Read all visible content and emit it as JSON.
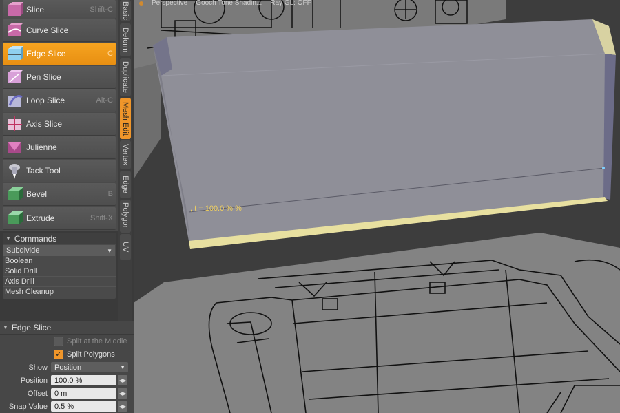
{
  "tools": [
    {
      "label": "Slice",
      "shortcut": "Shift-C",
      "icon": "slice-icon",
      "active": false
    },
    {
      "label": "Curve Slice",
      "shortcut": "",
      "icon": "curve-slice-icon",
      "active": false
    },
    {
      "label": "Edge Slice",
      "shortcut": "C",
      "icon": "edge-slice-icon",
      "active": true
    },
    {
      "label": "Pen Slice",
      "shortcut": "",
      "icon": "pen-slice-icon",
      "active": false
    },
    {
      "label": "Loop Slice",
      "shortcut": "Alt-C",
      "icon": "loop-slice-icon",
      "active": false
    },
    {
      "label": "Axis Slice",
      "shortcut": "",
      "icon": "axis-slice-icon",
      "active": false
    },
    {
      "label": "Julienne",
      "shortcut": "",
      "icon": "julienne-icon",
      "active": false
    },
    {
      "label": "Tack Tool",
      "shortcut": "",
      "icon": "tack-tool-icon",
      "active": false
    },
    {
      "label": "Bevel",
      "shortcut": "B",
      "icon": "bevel-icon",
      "active": false
    },
    {
      "label": "Extrude",
      "shortcut": "Shift-X",
      "icon": "extrude-icon",
      "active": false
    }
  ],
  "tabs": [
    {
      "label": "Basic",
      "active": false
    },
    {
      "label": "Deform",
      "active": false
    },
    {
      "label": "Duplicate",
      "active": false
    },
    {
      "label": "Mesh Edit",
      "active": true
    },
    {
      "label": "Vertex",
      "active": false
    },
    {
      "label": "Edge",
      "active": false
    },
    {
      "label": "Polygon",
      "active": false
    },
    {
      "label": "UV",
      "active": false
    }
  ],
  "commands": {
    "header": "Commands",
    "selected": "Subdivide",
    "items": [
      "Boolean",
      "Solid Drill",
      "Axis Drill",
      "Mesh Cleanup"
    ]
  },
  "properties": {
    "header": "Edge Slice",
    "split_middle_label": "Split at the Middle",
    "split_middle_checked": false,
    "split_polygons_label": "Split Polygons",
    "split_polygons_checked": true,
    "show_label": "Show",
    "show_value": "Position",
    "position_label": "Position",
    "position_value": "100.0 %",
    "offset_label": "Offset",
    "offset_value": "0 m",
    "snap_label": "Snap Value",
    "snap_value": "0.5 %"
  },
  "viewport": {
    "view_label": "Perspective",
    "shading_label": "Gooch Tone Shadin...",
    "ray_label": "Ray GL: OFF",
    "hud_text": ", t = 100.0 % %"
  },
  "colors": {
    "accent": "#f0962a",
    "mesh_face": "#8f8f98",
    "mesh_edge_highlight": "#e8e0a0",
    "hud_text": "#f0d060"
  }
}
